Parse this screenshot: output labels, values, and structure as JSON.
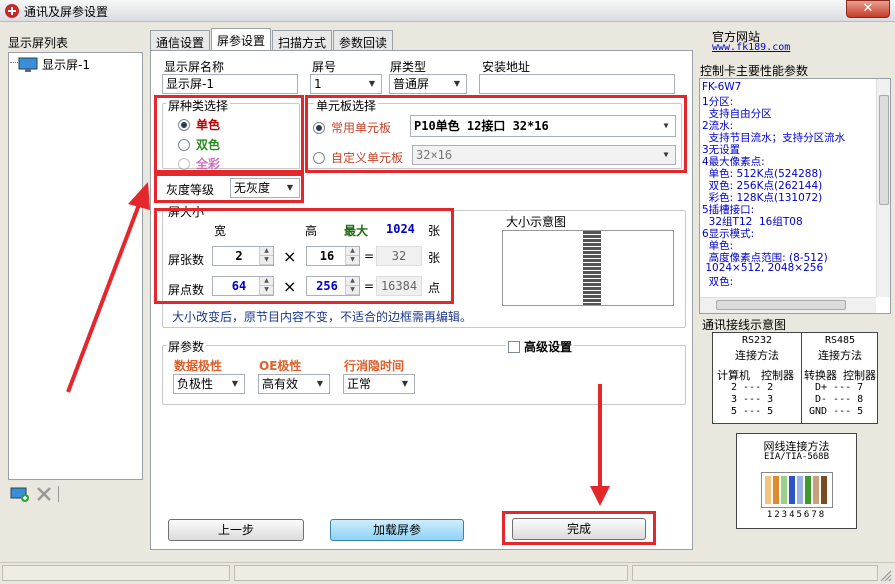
{
  "window": {
    "title": "通讯及屏参设置",
    "close_glyph": "✕"
  },
  "left": {
    "label": "显示屏列表",
    "tree_item": "显示屏-1"
  },
  "tabs": [
    "通信设置",
    "屏参设置",
    "扫描方式",
    "参数回读"
  ],
  "screen": {
    "name_label": "显示屏名称",
    "name_value": "显示屏-1",
    "no_label": "屏号",
    "no_value": "1",
    "type_label": "屏类型",
    "type_value": "普通屏",
    "addr_label": "安装地址",
    "addr_value": ""
  },
  "color_group": {
    "title": "屏种类选择",
    "options": [
      "单色",
      "双色",
      "全彩"
    ],
    "colors": [
      "#c00000",
      "#2b8a1e",
      "#d070c0"
    ]
  },
  "unit_group": {
    "title": "单元板选择",
    "common_label": "常用单元板",
    "common_value": "P10单色 12接口 32*16",
    "custom_label": "自定义单元板",
    "custom_value": "32×16"
  },
  "gray": {
    "label": "灰度等级",
    "value": "无灰度"
  },
  "size": {
    "title": "屏大小",
    "width_label": "宽",
    "height_label": "高",
    "max_label": "最大",
    "max_value": "1024",
    "unit_sheets": "张",
    "rows": [
      {
        "label": "屏张数",
        "w": "2",
        "h": "16",
        "result": "32",
        "unit": "张"
      },
      {
        "label": "屏点数",
        "w": "64",
        "h": "256",
        "result": "16384",
        "unit": "点"
      }
    ],
    "times": "×",
    "equals": "=",
    "note": "大小改变后，原节目内容不变，不适合的边框需再编辑。"
  },
  "preview": {
    "title": "大小示意图"
  },
  "params": {
    "title": "屏参数",
    "advanced_label": "高级设置",
    "data_pol_label": "数据极性",
    "data_pol_value": "负极性",
    "oe_label": "OE极性",
    "oe_value": "高有效",
    "blank_label": "行消隐时间",
    "blank_value": "正常"
  },
  "buttons": {
    "prev": "上一步",
    "load": "加载屏参",
    "finish": "完成"
  },
  "right": {
    "site_label": "官方网站",
    "site_url": "www.fk189.com",
    "perf_title": "控制卡主要性能参数",
    "perf_lines": [
      "FK-6W7",
      "1分区:",
      "  支持自由分区",
      "2流水:",
      "  支持节目流水；支持分区流水",
      "3无设置",
      "4最大像素点:",
      "  单色: 512K点(524288)",
      "  双色: 256K点(262144)",
      "  彩色: 128K点(131072)",
      "5插槽接口:",
      "  32组T12  16组T08",
      "6显示模式:",
      "  单色:",
      "  高度像素点范围: (8-512)",
      " 1024×512, 2048×256",
      "  双色:"
    ],
    "wiring_title": "通讯接线示意图",
    "rs232": {
      "title": "RS232",
      "sub": "连接方法",
      "h1": "计算机",
      "h2": "控制器",
      "rows": [
        "2 --- 2",
        "3 --- 3",
        "5 --- 5"
      ]
    },
    "rs485": {
      "title": "RS485",
      "sub": "连接方法",
      "h1": "转换器",
      "h2": "控制器",
      "rows": [
        "D+ --- 7",
        "D- --- 8",
        "GND --- 5"
      ]
    },
    "net_title": "网线连接方法",
    "net_std": "EIA/TIA-568B",
    "net_pins": "12345678"
  }
}
